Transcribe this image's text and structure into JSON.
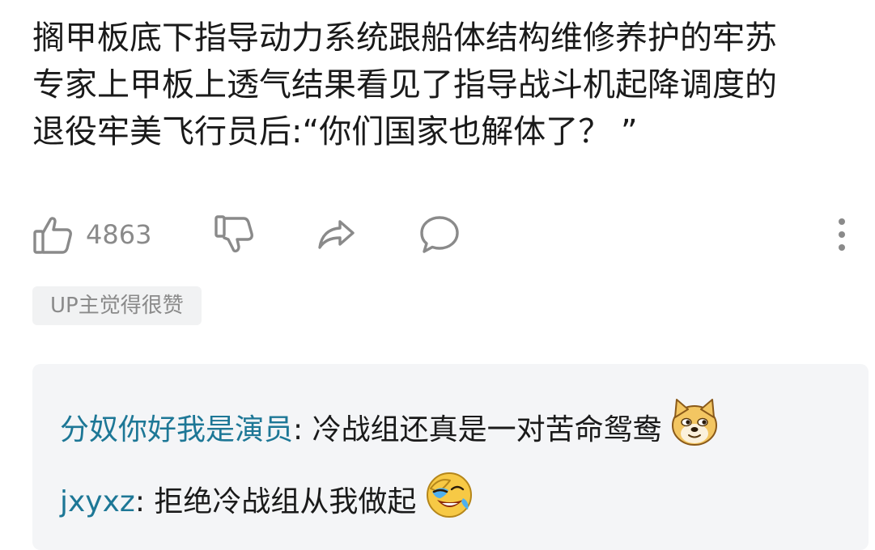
{
  "comment": {
    "text": "搁甲板底下指导动力系统跟船体结构维修养护的牢苏\n专家上甲板上透气结果看见了指导战斗机起降调度的\n退役牢美飞行员后:“你们国家也解体了？ ”"
  },
  "actions": {
    "like_count": "4863",
    "like_icon": "thumbs-up-icon",
    "dislike_icon": "thumbs-down-icon",
    "share_icon": "share-icon",
    "reply_icon": "comment-bubble-icon",
    "more_icon": "more-vertical-icon"
  },
  "badge": {
    "label": "UP主觉得很赞"
  },
  "replies": [
    {
      "user": "分奴你好我是演员",
      "separator": ":",
      "text": " 冷战组还真是一对苦命鸳鸯",
      "emote": "doge-emote"
    },
    {
      "user": "jxyxz",
      "separator": ":",
      "text": " 拒绝冷战组从我做起",
      "emote": "laughing-crying-emote"
    }
  ],
  "colors": {
    "username": "#1d7796",
    "icon_gray": "#8a8a8a",
    "reply_bg": "#f4f5f7"
  }
}
